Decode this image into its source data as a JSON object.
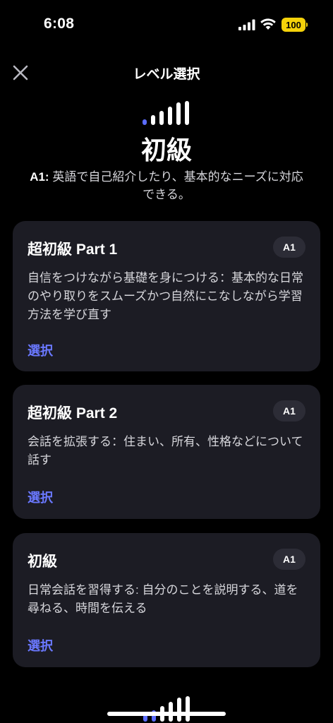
{
  "status_bar": {
    "time": "6:08",
    "battery": "100",
    "battery_color": "#f5d20a",
    "icons": [
      "signal-icon",
      "wifi-icon",
      "battery-icon"
    ]
  },
  "header": {
    "title": "レベル選択",
    "close_icon": "close-icon"
  },
  "level": {
    "name": "初級",
    "code": "A1",
    "code_separator": ":",
    "description": "英語で自己紹介したり、基本的なニーズに対応できる。",
    "indicator_icon": "level-bars-icon",
    "active_color": "#5b6cff",
    "inactive_color": "#ffffff"
  },
  "cards": [
    {
      "title": "超初級 Part 1",
      "badge": "A1",
      "description": "自信をつけながら基礎を身につける：基本的な日常のやり取りをスムーズかつ自然にこなしながら学習方法を学び直す",
      "action": "選択"
    },
    {
      "title": "超初級 Part 2",
      "badge": "A1",
      "description": "会話を拡張する：住まい、所有、性格などについて話す",
      "action": "選択"
    },
    {
      "title": "初級",
      "badge": "A1",
      "description": "日常会話を習得する: 自分のことを説明する、道を尋ねる、時間を伝える",
      "action": "選択"
    }
  ],
  "accent_color": "#6a78ff"
}
